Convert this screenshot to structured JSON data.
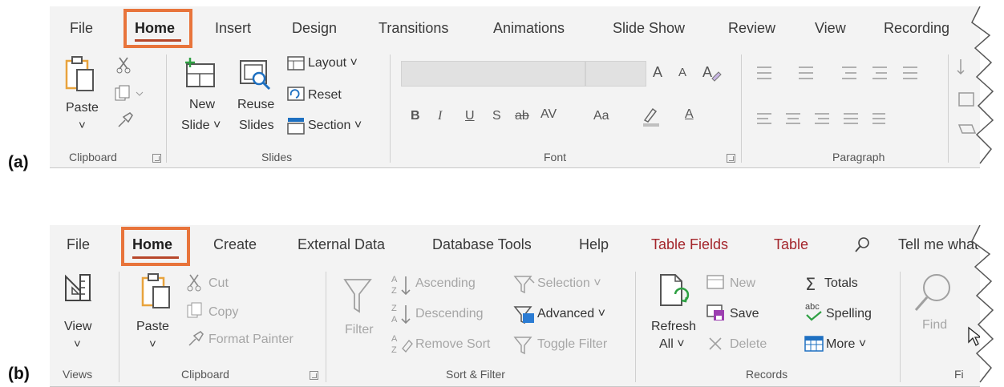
{
  "figure_labels": {
    "a": "(a)",
    "b": "(b)"
  },
  "colors": {
    "accent_underline": "#b7472a",
    "highlight": "#e8743b",
    "context_tab": "#a4262c",
    "ribbon_bg": "#f3f3f3"
  },
  "ribbon_a": {
    "tabs": [
      "File",
      "Home",
      "Insert",
      "Design",
      "Transitions",
      "Animations",
      "Slide Show",
      "Review",
      "View",
      "Recording"
    ],
    "active_tab": "Home",
    "clipboard": {
      "paste": "Paste",
      "paste_arrow": "˅",
      "group": "Clipboard"
    },
    "slides": {
      "new_slide_1": "New",
      "new_slide_2": "Slide ˅",
      "reuse_1": "Reuse",
      "reuse_2": "Slides",
      "layout": "Layout ˅",
      "reset": "Reset",
      "section": "Section ˅",
      "group": "Slides"
    },
    "font": {
      "bold": "B",
      "italic": "I",
      "underline": "U",
      "shadow": "S",
      "strike": "ab",
      "spacing": "AV",
      "case": "Aa",
      "color": "A",
      "grow": "A",
      "shrink": "A",
      "group": "Font"
    },
    "paragraph": {
      "group": "Paragraph"
    }
  },
  "ribbon_b": {
    "tabs": [
      "File",
      "Home",
      "Create",
      "External Data",
      "Database Tools",
      "Help",
      "Table Fields",
      "Table",
      "Tell me what"
    ],
    "active_tab": "Home",
    "views": {
      "view": "View",
      "view_arrow": "˅",
      "group": "Views"
    },
    "clipboard": {
      "paste": "Paste",
      "paste_arrow": "˅",
      "cut": "Cut",
      "copy": "Copy",
      "format_painter": "Format Painter",
      "group": "Clipboard"
    },
    "sort_filter": {
      "filter": "Filter",
      "ascending": "Ascending",
      "descending": "Descending",
      "remove_sort": "Remove Sort",
      "selection": "Selection ˅",
      "advanced": "Advanced ˅",
      "toggle_filter": "Toggle Filter",
      "group": "Sort & Filter"
    },
    "records": {
      "refresh_1": "Refresh",
      "refresh_2": "All ˅",
      "new": "New",
      "save": "Save",
      "delete": "Delete",
      "totals": "Totals",
      "spelling": "Spelling",
      "more": "More ˅",
      "group": "Records"
    },
    "find": {
      "find": "Find",
      "group": "Fi"
    }
  }
}
